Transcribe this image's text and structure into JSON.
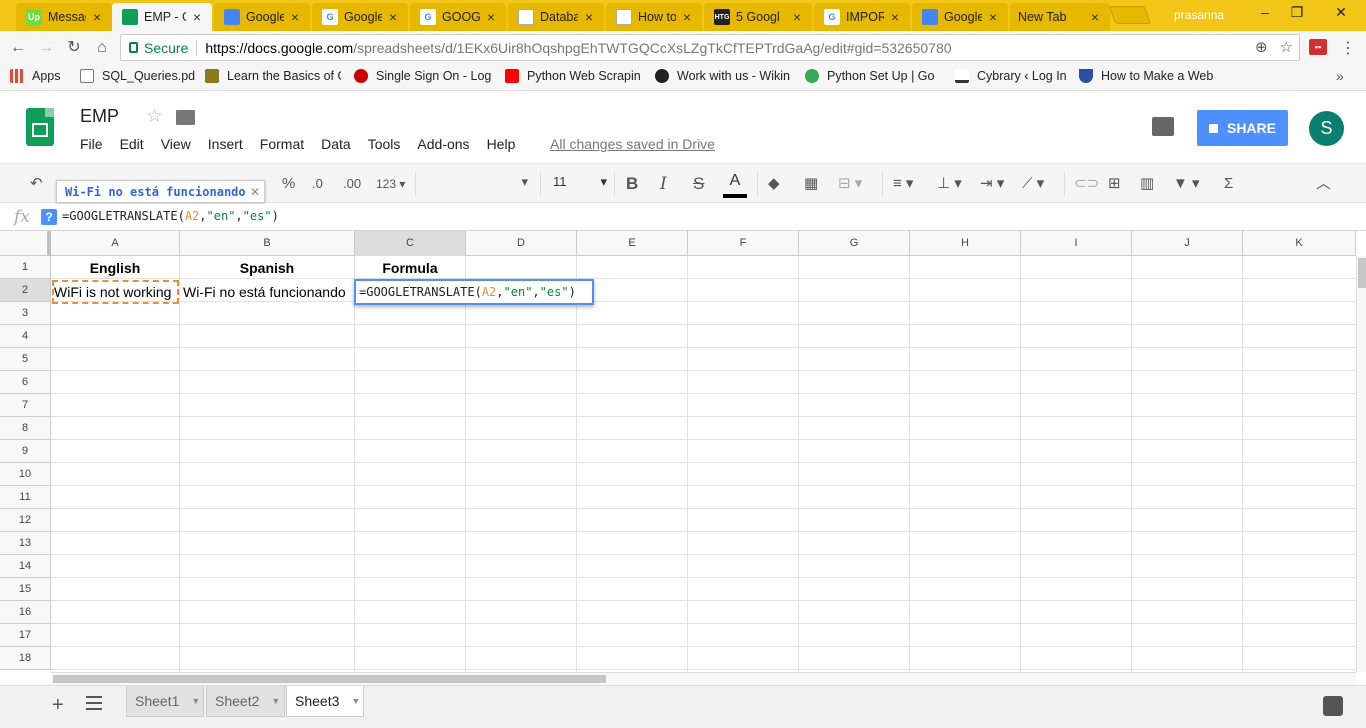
{
  "browser": {
    "tabs": [
      {
        "title": "Messag",
        "fav": "Up",
        "color": "#6fda44"
      },
      {
        "title": "EMP - G",
        "fav": "",
        "color": "#0f9d58"
      },
      {
        "title": "Google",
        "fav": "",
        "color": "#4285f4"
      },
      {
        "title": "Google",
        "fav": "G",
        "color": "#ffffff"
      },
      {
        "title": "GOOGL",
        "fav": "G",
        "color": "#ffffff"
      },
      {
        "title": "Databa",
        "fav": "",
        "color": "#ffffff"
      },
      {
        "title": "How to",
        "fav": "",
        "color": "#ffffff"
      },
      {
        "title": "5 Googl",
        "fav": "HTG",
        "color": "#222222"
      },
      {
        "title": "IMPORT",
        "fav": "G",
        "color": "#ffffff"
      },
      {
        "title": "Google",
        "fav": "",
        "color": "#4285f4"
      },
      {
        "title": "New Tab",
        "fav": "",
        "color": "#ffffff"
      }
    ],
    "profile": "prasanna",
    "secure_label": "Secure",
    "url_host": "https://docs.google.com",
    "url_path": "/spreadsheets/d/1EKx6Uir8hOqshpgEhTWTGQCcXsLZgTkCfTEPTrdGaAg/edit#gid=532650780",
    "bookmarks": [
      {
        "label": "Apps",
        "color": "#e8453c"
      },
      {
        "label": "SQL_Queries.pdf",
        "color": "#ffffff"
      },
      {
        "label": "Learn the Basics of G",
        "color": "#8a7a1c"
      },
      {
        "label": "Single Sign On - Log",
        "color": "#cc0000"
      },
      {
        "label": "Python Web Scrapin",
        "color": "#ff0000"
      },
      {
        "label": "Work with us - Wikin",
        "color": "#222222"
      },
      {
        "label": "Python Set Up | Go",
        "color": "#34a853"
      },
      {
        "label": "Cybrary ‹ Log In",
        "color": "#ffffff"
      },
      {
        "label": "How to Make a Web",
        "color": "#2b4f9e"
      }
    ]
  },
  "sheets": {
    "doc_title": "EMP",
    "menu": [
      "File",
      "Edit",
      "View",
      "Insert",
      "Format",
      "Data",
      "Tools",
      "Add-ons",
      "Help"
    ],
    "saved_status": "All changes saved in Drive",
    "share_label": "SHARE",
    "avatar_letter": "S",
    "toolbar": {
      "percent": "%",
      "dec_less": ".0",
      "dec_more": ".00",
      "num_format": "123",
      "font_size": "11",
      "bold": "B",
      "italic": "I",
      "strike": "S",
      "text_color": "A",
      "sum": "Σ"
    },
    "tooltip": "Wi-Fi no está funcionando",
    "formula_bar": {
      "fx": "fx",
      "help": "?",
      "fn": "=GOOGLETRANSLATE",
      "open": "(",
      "ref": "A2",
      "comma1": ",",
      "arg1": "\"en\"",
      "comma2": ",",
      "arg2": "\"es\"",
      "close": ")"
    },
    "columns": [
      "A",
      "B",
      "C",
      "D",
      "E",
      "F",
      "G",
      "H",
      "I",
      "J",
      "K"
    ],
    "rows": [
      "1",
      "2",
      "3",
      "4",
      "5",
      "6",
      "7",
      "8",
      "9",
      "10",
      "11",
      "12",
      "13",
      "14",
      "15",
      "16",
      "17",
      "18"
    ],
    "cells": {
      "A1": "English",
      "B1": "Spanish",
      "C1": "Formula",
      "A2": "WiFi is not working",
      "B2": "Wi-Fi no está funcionando"
    },
    "sheet_tabs": [
      "Sheet1",
      "Sheet2",
      "Sheet3"
    ],
    "active_sheet": "Sheet3"
  }
}
